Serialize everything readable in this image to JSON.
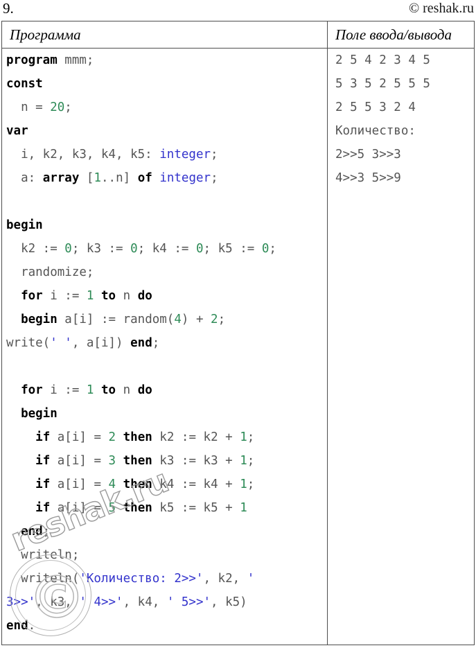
{
  "header": {
    "problem_number": "9.",
    "copyright": "© reshak.ru"
  },
  "table": {
    "columns": [
      {
        "key": "program",
        "title": "Программа"
      },
      {
        "key": "output",
        "title": "Поле ввода/вывода"
      }
    ]
  },
  "program": {
    "language": "pascal",
    "lines": [
      [
        {
          "t": "program",
          "c": "kw"
        },
        {
          "t": " mmm;",
          "c": "pln"
        }
      ],
      [
        {
          "t": "const",
          "c": "kw"
        }
      ],
      [
        {
          "t": "  n = ",
          "c": "pln"
        },
        {
          "t": "20",
          "c": "num"
        },
        {
          "t": ";",
          "c": "pln"
        }
      ],
      [
        {
          "t": "var",
          "c": "kw"
        }
      ],
      [
        {
          "t": "  i, k2, k3, k4, k5: ",
          "c": "pln"
        },
        {
          "t": "integer",
          "c": "typ"
        },
        {
          "t": ";",
          "c": "pln"
        }
      ],
      [
        {
          "t": "  a: ",
          "c": "pln"
        },
        {
          "t": "array",
          "c": "kw"
        },
        {
          "t": " [",
          "c": "pln"
        },
        {
          "t": "1",
          "c": "num"
        },
        {
          "t": "..n] ",
          "c": "pln"
        },
        {
          "t": "of",
          "c": "kw"
        },
        {
          "t": " ",
          "c": "pln"
        },
        {
          "t": "integer",
          "c": "typ"
        },
        {
          "t": ";",
          "c": "pln"
        }
      ],
      [],
      [
        {
          "t": "begin",
          "c": "kw"
        }
      ],
      [
        {
          "t": "  k2 := ",
          "c": "pln"
        },
        {
          "t": "0",
          "c": "num"
        },
        {
          "t": "; k3 := ",
          "c": "pln"
        },
        {
          "t": "0",
          "c": "num"
        },
        {
          "t": "; k4 := ",
          "c": "pln"
        },
        {
          "t": "0",
          "c": "num"
        },
        {
          "t": "; k5 := ",
          "c": "pln"
        },
        {
          "t": "0",
          "c": "num"
        },
        {
          "t": ";",
          "c": "pln"
        }
      ],
      [
        {
          "t": "  randomize;",
          "c": "pln"
        }
      ],
      [
        {
          "t": "  ",
          "c": "pln"
        },
        {
          "t": "for",
          "c": "kw"
        },
        {
          "t": " i := ",
          "c": "pln"
        },
        {
          "t": "1",
          "c": "num"
        },
        {
          "t": " ",
          "c": "pln"
        },
        {
          "t": "to",
          "c": "kw"
        },
        {
          "t": " n ",
          "c": "pln"
        },
        {
          "t": "do",
          "c": "kw"
        }
      ],
      [
        {
          "t": "  ",
          "c": "pln"
        },
        {
          "t": "begin",
          "c": "kw"
        },
        {
          "t": " a[i] := random(",
          "c": "pln"
        },
        {
          "t": "4",
          "c": "num"
        },
        {
          "t": ") + ",
          "c": "pln"
        },
        {
          "t": "2",
          "c": "num"
        },
        {
          "t": ";",
          "c": "pln"
        }
      ],
      [
        {
          "t": "write(",
          "c": "pln"
        },
        {
          "t": "' '",
          "c": "str"
        },
        {
          "t": ", a[i]) ",
          "c": "pln"
        },
        {
          "t": "end",
          "c": "kw"
        },
        {
          "t": ";",
          "c": "pln"
        }
      ],
      [],
      [
        {
          "t": "  ",
          "c": "pln"
        },
        {
          "t": "for",
          "c": "kw"
        },
        {
          "t": " i := ",
          "c": "pln"
        },
        {
          "t": "1",
          "c": "num"
        },
        {
          "t": " ",
          "c": "pln"
        },
        {
          "t": "to",
          "c": "kw"
        },
        {
          "t": " n ",
          "c": "pln"
        },
        {
          "t": "do",
          "c": "kw"
        }
      ],
      [
        {
          "t": "  ",
          "c": "pln"
        },
        {
          "t": "begin",
          "c": "kw"
        }
      ],
      [
        {
          "t": "    ",
          "c": "pln"
        },
        {
          "t": "if",
          "c": "kw"
        },
        {
          "t": " a[i] = ",
          "c": "pln"
        },
        {
          "t": "2",
          "c": "num"
        },
        {
          "t": " ",
          "c": "pln"
        },
        {
          "t": "then",
          "c": "kw"
        },
        {
          "t": " k2 := k2 + ",
          "c": "pln"
        },
        {
          "t": "1",
          "c": "num"
        },
        {
          "t": ";",
          "c": "pln"
        }
      ],
      [
        {
          "t": "    ",
          "c": "pln"
        },
        {
          "t": "if",
          "c": "kw"
        },
        {
          "t": " a[i] = ",
          "c": "pln"
        },
        {
          "t": "3",
          "c": "num"
        },
        {
          "t": " ",
          "c": "pln"
        },
        {
          "t": "then",
          "c": "kw"
        },
        {
          "t": " k3 := k3 + ",
          "c": "pln"
        },
        {
          "t": "1",
          "c": "num"
        },
        {
          "t": ";",
          "c": "pln"
        }
      ],
      [
        {
          "t": "    ",
          "c": "pln"
        },
        {
          "t": "if",
          "c": "kw"
        },
        {
          "t": " a[i] = ",
          "c": "pln"
        },
        {
          "t": "4",
          "c": "num"
        },
        {
          "t": " ",
          "c": "pln"
        },
        {
          "t": "then",
          "c": "kw"
        },
        {
          "t": " k4 := k4 + ",
          "c": "pln"
        },
        {
          "t": "1",
          "c": "num"
        },
        {
          "t": ";",
          "c": "pln"
        }
      ],
      [
        {
          "t": "    ",
          "c": "pln"
        },
        {
          "t": "if",
          "c": "kw"
        },
        {
          "t": " a[i] = ",
          "c": "pln"
        },
        {
          "t": "5",
          "c": "num"
        },
        {
          "t": " ",
          "c": "pln"
        },
        {
          "t": "then",
          "c": "kw"
        },
        {
          "t": " k5 := k5 + ",
          "c": "pln"
        },
        {
          "t": "1",
          "c": "num"
        }
      ],
      [
        {
          "t": "  ",
          "c": "pln"
        },
        {
          "t": "end",
          "c": "kw"
        },
        {
          "t": ";",
          "c": "pln"
        }
      ],
      [
        {
          "t": "  writeln;",
          "c": "pln"
        }
      ],
      [
        {
          "t": "  writeln(",
          "c": "pln"
        },
        {
          "t": "'Количество: 2>>'",
          "c": "str"
        },
        {
          "t": ", k2, ",
          "c": "pln"
        },
        {
          "t": "'",
          "c": "str"
        }
      ],
      [
        {
          "t": "3>>'",
          "c": "str"
        },
        {
          "t": ", k3, ",
          "c": "pln"
        },
        {
          "t": "' 4>>'",
          "c": "str"
        },
        {
          "t": ", k4, ",
          "c": "pln"
        },
        {
          "t": "' 5>>'",
          "c": "str"
        },
        {
          "t": ", k5)",
          "c": "pln"
        }
      ],
      [
        {
          "t": "end",
          "c": "kw"
        },
        {
          "t": ".",
          "c": "pln"
        }
      ]
    ]
  },
  "output": {
    "lines": [
      "2 5 4 2 3 4 5",
      "5 3 5 2 5 5 5",
      "2 5 5 3 2 4",
      "Количество:",
      "2>>5 3>>3",
      "4>>3 5>>9"
    ],
    "array_values": [
      2,
      5,
      4,
      2,
      3,
      4,
      5,
      5,
      3,
      5,
      2,
      5,
      5,
      5,
      2,
      5,
      5,
      3,
      2,
      4
    ],
    "counts": {
      "2": 5,
      "3": 3,
      "4": 3,
      "5": 9
    },
    "counts_label": "Количество:"
  },
  "watermark": {
    "text": "reshak.ru",
    "symbol": "©"
  },
  "colors": {
    "keyword": "#000000",
    "number": "#2e8b57",
    "type": "#3333cc",
    "string": "#3333cc",
    "plain": "#555555",
    "border": "#4d4d4d",
    "watermark": "#9a9a9a"
  }
}
